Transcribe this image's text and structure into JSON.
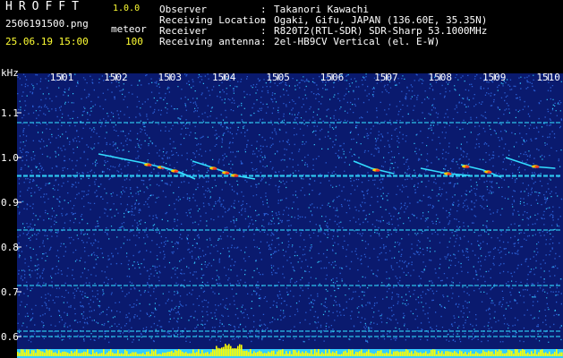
{
  "app": {
    "title": "HROFFT",
    "version": "1.0.0"
  },
  "capture": {
    "filename": "2506191500.png",
    "mode": "meteor",
    "datetime": "25.06.19 15:00",
    "count": "100"
  },
  "info": [
    {
      "label": "Observer",
      "value": "Takanori Kawachi"
    },
    {
      "label": "Receiving Location",
      "value": "Ogaki, Gifu, JAPAN (136.60E, 35.35N)"
    },
    {
      "label": "Receiver",
      "value": "R820T2(RTL-SDR) SDR-Sharp 53.1000MHz"
    },
    {
      "label": "Receiving antenna",
      "value": "2el-HB9CV Vertical (el. E-W)"
    }
  ],
  "separator": ":",
  "axis": {
    "y_unit": "kHz",
    "x_ticks": [
      "1501",
      "1502",
      "1503",
      "1504",
      "1505",
      "1506",
      "1507",
      "1508",
      "1509",
      "1510"
    ],
    "y_ticks": [
      "1.1",
      "1.0",
      "0.9",
      "0.8",
      "0.7",
      "0.6"
    ]
  },
  "colors": {
    "background": "#000000",
    "plot_bg": "#0a1a6e",
    "noise_light": "#2a5fd4",
    "noise_cyan": "#33ccff",
    "meteor_hot": "#ff3322",
    "meteor_warm": "#ffcc00",
    "signal_line": "#33ddff",
    "baseline": "#33ccff",
    "baseline_peaks": "#ffff00"
  }
}
